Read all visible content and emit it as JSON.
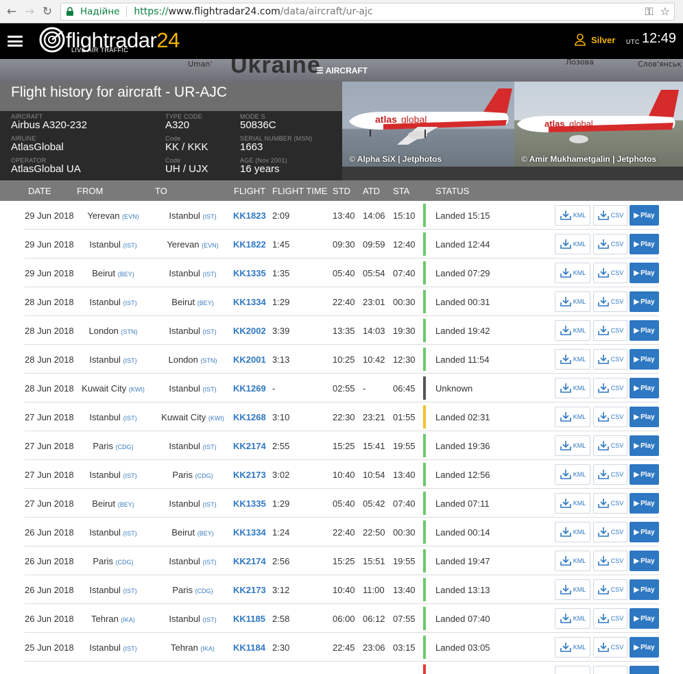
{
  "browser": {
    "secure_label": "Надійне",
    "url_scheme": "https://",
    "url_host": "www.flightradar24.com",
    "url_path": "/data/aircraft/ur-ajc"
  },
  "header": {
    "logo_main": "flightradar",
    "logo_num": "24",
    "logo_sub": "LIVE AIR TRAFFIC",
    "user": "Silver",
    "utc_label": "UTC",
    "time": "12:49"
  },
  "map": {
    "labels": [
      "Uman'",
      "Ukraine",
      "Лозова",
      "Слов'янськ"
    ]
  },
  "aircraft_tab": "AIRCRAFT",
  "page_title": "Flight history for aircraft - UR-AJC",
  "details": {
    "aircraft_label": "AIRCRAFT",
    "aircraft": "Airbus A320-232",
    "airline_label": "AIRLINE",
    "airline": "AtlasGlobal",
    "operator_label": "OPERATOR",
    "operator": "AtlasGlobal UA",
    "type_code_label": "TYPE CODE",
    "type_code": "A320",
    "code_label_1": "Code",
    "airline_code": "KK / KKK",
    "code_label_2": "Code",
    "operator_code": "UH / UJX",
    "mode_s_label": "MODE S",
    "mode_s": "50836C",
    "msn_label": "SERIAL NUMBER (MSN)",
    "msn": "1663",
    "age_label": "AGE (Nov 2001)",
    "age": "16 years"
  },
  "photos": [
    {
      "credit": "© Alpha SiX | Jetphotos"
    },
    {
      "credit": "© Amir Mukhametgalin | Jetphotos"
    }
  ],
  "columns": {
    "date": "DATE",
    "from": "FROM",
    "to": "TO",
    "flight": "FLIGHT",
    "flight_time": "FLIGHT TIME",
    "std": "STD",
    "atd": "ATD",
    "sta": "STA",
    "status": "STATUS"
  },
  "buttons": {
    "kml": "KML",
    "csv": "CSV",
    "play": "Play"
  },
  "colors": {
    "landed": "#6cc96e",
    "unknown": "#555555",
    "delayed": "#f2c12e",
    "red": "#e53935",
    "link": "#2e77c2"
  },
  "flights": [
    {
      "date": "29 Jun 2018",
      "from": "Yerevan",
      "from_code": "(EVN)",
      "to": "Istanbul",
      "to_code": "(IST)",
      "flight": "KK1823",
      "time": "2:09",
      "std": "13:40",
      "atd": "14:06",
      "sta": "15:10",
      "status": "Landed 15:15",
      "state": "landed"
    },
    {
      "date": "29 Jun 2018",
      "from": "Istanbul",
      "from_code": "(IST)",
      "to": "Yerevan",
      "to_code": "(EVN)",
      "flight": "KK1822",
      "time": "1:45",
      "std": "09:30",
      "atd": "09:59",
      "sta": "12:40",
      "status": "Landed 12:44",
      "state": "landed"
    },
    {
      "date": "29 Jun 2018",
      "from": "Beirut",
      "from_code": "(BEY)",
      "to": "Istanbul",
      "to_code": "(IST)",
      "flight": "KK1335",
      "time": "1:35",
      "std": "05:40",
      "atd": "05:54",
      "sta": "07:40",
      "status": "Landed 07:29",
      "state": "landed"
    },
    {
      "date": "28 Jun 2018",
      "from": "Istanbul",
      "from_code": "(IST)",
      "to": "Beirut",
      "to_code": "(BEY)",
      "flight": "KK1334",
      "time": "1:29",
      "std": "22:40",
      "atd": "23:01",
      "sta": "00:30",
      "status": "Landed 00:31",
      "state": "landed"
    },
    {
      "date": "28 Jun 2018",
      "from": "London",
      "from_code": "(STN)",
      "to": "Istanbul",
      "to_code": "(IST)",
      "flight": "KK2002",
      "time": "3:39",
      "std": "13:35",
      "atd": "14:03",
      "sta": "19:30",
      "status": "Landed 19:42",
      "state": "landed"
    },
    {
      "date": "28 Jun 2018",
      "from": "Istanbul",
      "from_code": "(IST)",
      "to": "London",
      "to_code": "(STN)",
      "flight": "KK2001",
      "time": "3:13",
      "std": "10:25",
      "atd": "10:42",
      "sta": "12:30",
      "status": "Landed 11:54",
      "state": "landed"
    },
    {
      "date": "28 Jun 2018",
      "from": "Kuwait City",
      "from_code": "(KWI)",
      "to": "Istanbul",
      "to_code": "(IST)",
      "flight": "KK1269",
      "time": "-",
      "std": "02:55",
      "atd": "-",
      "sta": "06:45",
      "status": "Unknown",
      "state": "unknown"
    },
    {
      "date": "27 Jun 2018",
      "from": "Istanbul",
      "from_code": "(IST)",
      "to": "Kuwait City",
      "to_code": "(KWI)",
      "flight": "KK1268",
      "time": "3:10",
      "std": "22:30",
      "atd": "23:21",
      "sta": "01:55",
      "status": "Landed 02:31",
      "state": "delayed"
    },
    {
      "date": "27 Jun 2018",
      "from": "Paris",
      "from_code": "(CDG)",
      "to": "Istanbul",
      "to_code": "(IST)",
      "flight": "KK2174",
      "time": "2:55",
      "std": "15:25",
      "atd": "15:41",
      "sta": "19:55",
      "status": "Landed 19:36",
      "state": "landed"
    },
    {
      "date": "27 Jun 2018",
      "from": "Istanbul",
      "from_code": "(IST)",
      "to": "Paris",
      "to_code": "(CDG)",
      "flight": "KK2173",
      "time": "3:02",
      "std": "10:40",
      "atd": "10:54",
      "sta": "13:40",
      "status": "Landed 12:56",
      "state": "landed"
    },
    {
      "date": "27 Jun 2018",
      "from": "Beirut",
      "from_code": "(BEY)",
      "to": "Istanbul",
      "to_code": "(IST)",
      "flight": "KK1335",
      "time": "1:29",
      "std": "05:40",
      "atd": "05:42",
      "sta": "07:40",
      "status": "Landed 07:11",
      "state": "landed"
    },
    {
      "date": "26 Jun 2018",
      "from": "Istanbul",
      "from_code": "(IST)",
      "to": "Beirut",
      "to_code": "(BEY)",
      "flight": "KK1334",
      "time": "1:24",
      "std": "22:40",
      "atd": "22:50",
      "sta": "00:30",
      "status": "Landed 00:14",
      "state": "landed"
    },
    {
      "date": "26 Jun 2018",
      "from": "Paris",
      "from_code": "(CDG)",
      "to": "Istanbul",
      "to_code": "(IST)",
      "flight": "KK2174",
      "time": "2:56",
      "std": "15:25",
      "atd": "15:51",
      "sta": "19:55",
      "status": "Landed 19:47",
      "state": "landed"
    },
    {
      "date": "26 Jun 2018",
      "from": "Istanbul",
      "from_code": "(IST)",
      "to": "Paris",
      "to_code": "(CDG)",
      "flight": "KK2173",
      "time": "3:12",
      "std": "10:40",
      "atd": "11:00",
      "sta": "13:40",
      "status": "Landed 13:13",
      "state": "landed"
    },
    {
      "date": "26 Jun 2018",
      "from": "Tehran",
      "from_code": "(IKA)",
      "to": "Istanbul",
      "to_code": "(IST)",
      "flight": "KK1185",
      "time": "2:58",
      "std": "06:00",
      "atd": "06:12",
      "sta": "07:55",
      "status": "Landed 07:40",
      "state": "landed"
    },
    {
      "date": "25 Jun 2018",
      "from": "Istanbul",
      "from_code": "(IST)",
      "to": "Tehran",
      "to_code": "(IKA)",
      "flight": "KK1184",
      "time": "2:30",
      "std": "22:45",
      "atd": "23:06",
      "sta": "03:15",
      "status": "Landed 03:05",
      "state": "landed"
    }
  ]
}
